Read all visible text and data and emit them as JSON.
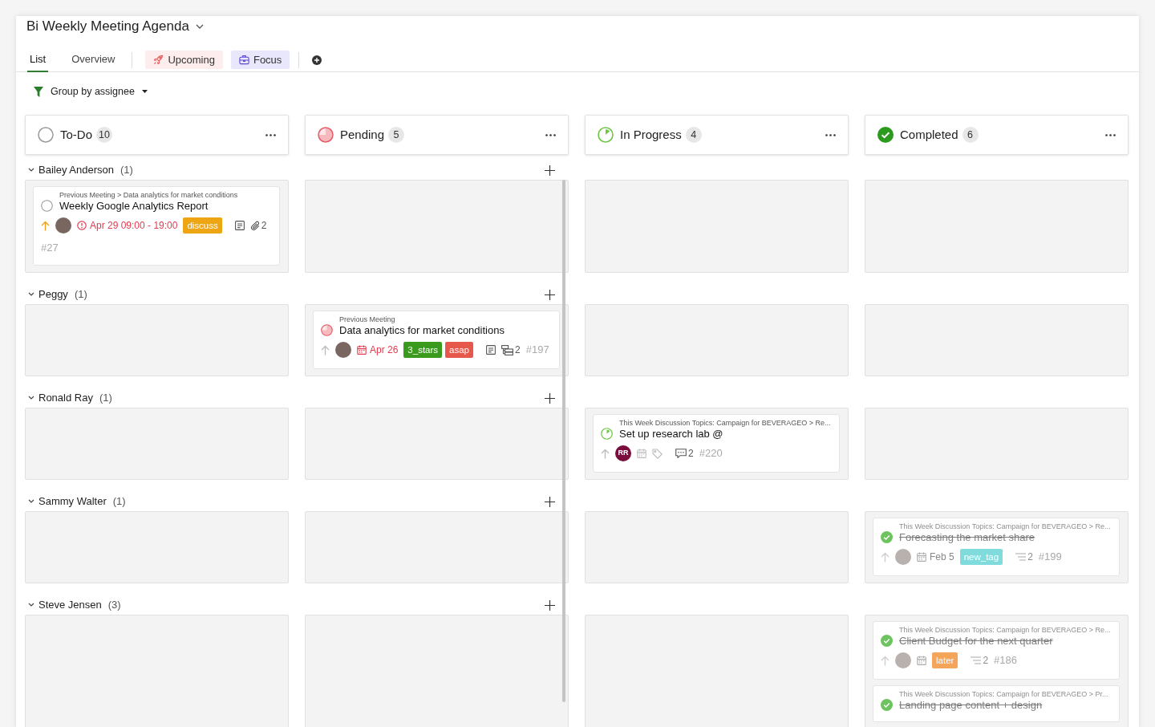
{
  "title": "Bi Weekly Meeting Agenda",
  "tabs": [
    {
      "label": "List",
      "kind": "plain",
      "selected": true
    },
    {
      "label": "Overview",
      "kind": "plain",
      "selected": false
    },
    {
      "label": "Upcoming",
      "kind": "rocket",
      "selected": false
    },
    {
      "label": "Focus",
      "kind": "briefcase",
      "selected": false
    }
  ],
  "group_by": {
    "label": "Group by assignee"
  },
  "columns": [
    {
      "name": "To-Do",
      "count": "10",
      "kind": "todo"
    },
    {
      "name": "Pending",
      "count": "5",
      "kind": "pending"
    },
    {
      "name": "In Progress",
      "count": "4",
      "kind": "in_progress"
    },
    {
      "name": "Completed",
      "count": "6",
      "kind": "done"
    }
  ],
  "groups": [
    {
      "name": "Bailey Anderson",
      "count": "(1)",
      "expanded": true,
      "cards": [
        {
          "kind": "todo",
          "breadcrumb": "Previous Meeting > Data analytics for market conditions",
          "title": "Weekly Google Analytics Report",
          "high_priority": true,
          "assignee": {
            "kind": "photo"
          },
          "date": {
            "kind": "timed",
            "text": "Apr 29 09:00 - 19:00",
            "overdue": true
          },
          "tags": [
            {
              "label": "discuss",
              "color": "#eda513"
            }
          ],
          "indicators": [
            {
              "kind": "note"
            },
            {
              "kind": "attachment",
              "count": "2"
            }
          ],
          "number": "#27"
        }
      ]
    },
    {
      "name": "Peggy",
      "count": "(1)",
      "expanded": true,
      "cards": [
        {
          "kind": "pending",
          "breadcrumb": "Previous Meeting",
          "title": "Data analytics for market conditions",
          "high_priority": false,
          "assignee": {
            "kind": "photo"
          },
          "date": {
            "kind": "day",
            "text": "Apr 26",
            "overdue": true
          },
          "tags": [
            {
              "label": "3_stars",
              "color": "#3a9a1e"
            },
            {
              "label": "asap",
              "color": "#e6574c"
            }
          ],
          "indicators": [
            {
              "kind": "note"
            },
            {
              "kind": "subtasks",
              "count": "2"
            }
          ],
          "number": "#197"
        }
      ]
    },
    {
      "name": "Ronald Ray",
      "count": "(1)",
      "expanded": true,
      "cards": [
        {
          "kind": "in_progress",
          "breadcrumb": "This Week Discussion Topics: Campaign for BEVERAGEO > Re...",
          "title": "Set up research lab @",
          "high_priority": false,
          "assignee": {
            "kind": "initials",
            "initials": "RR",
            "color": "#7b0d3d"
          },
          "date": {
            "kind": "day",
            "overdue": false
          },
          "indicators": [
            {
              "kind": "comments",
              "count": "2"
            }
          ],
          "number": "#220"
        }
      ]
    },
    {
      "name": "Sammy Walter",
      "count": "(1)",
      "expanded": true,
      "cards": [
        {
          "kind": "done",
          "breadcrumb": "This Week Discussion Topics: Campaign for BEVERAGEO > Re...",
          "title": "Forecasting the market share",
          "high_priority": false,
          "assignee": {
            "kind": "photo"
          },
          "date": {
            "kind": "day",
            "text": "Feb 5",
            "overdue": false
          },
          "tags": [
            {
              "label": "new_tag",
              "color": "#80dcdc"
            }
          ],
          "indicators": [
            {
              "kind": "checklist",
              "count": "2"
            }
          ],
          "number": "#199"
        }
      ]
    },
    {
      "name": "Steve Jensen",
      "count": "(3)",
      "expanded": true,
      "cards": [
        {
          "kind": "done",
          "breadcrumb": "This Week Discussion Topics: Campaign for BEVERAGEO > Re...",
          "title": "Client Budget for the next quarter",
          "high_priority": false,
          "assignee": {
            "kind": "photo"
          },
          "date": {
            "kind": "day",
            "overdue": false
          },
          "tags": [
            {
              "label": "later",
              "color": "#f4a55a"
            }
          ],
          "indicators": [
            {
              "kind": "checklist",
              "count": "2"
            }
          ],
          "number": "#186"
        },
        {
          "kind": "done",
          "breadcrumb": "This Week Discussion Topics: Campaign for BEVERAGEO > Pr...",
          "title": "Landing page content + design"
        }
      ]
    }
  ]
}
